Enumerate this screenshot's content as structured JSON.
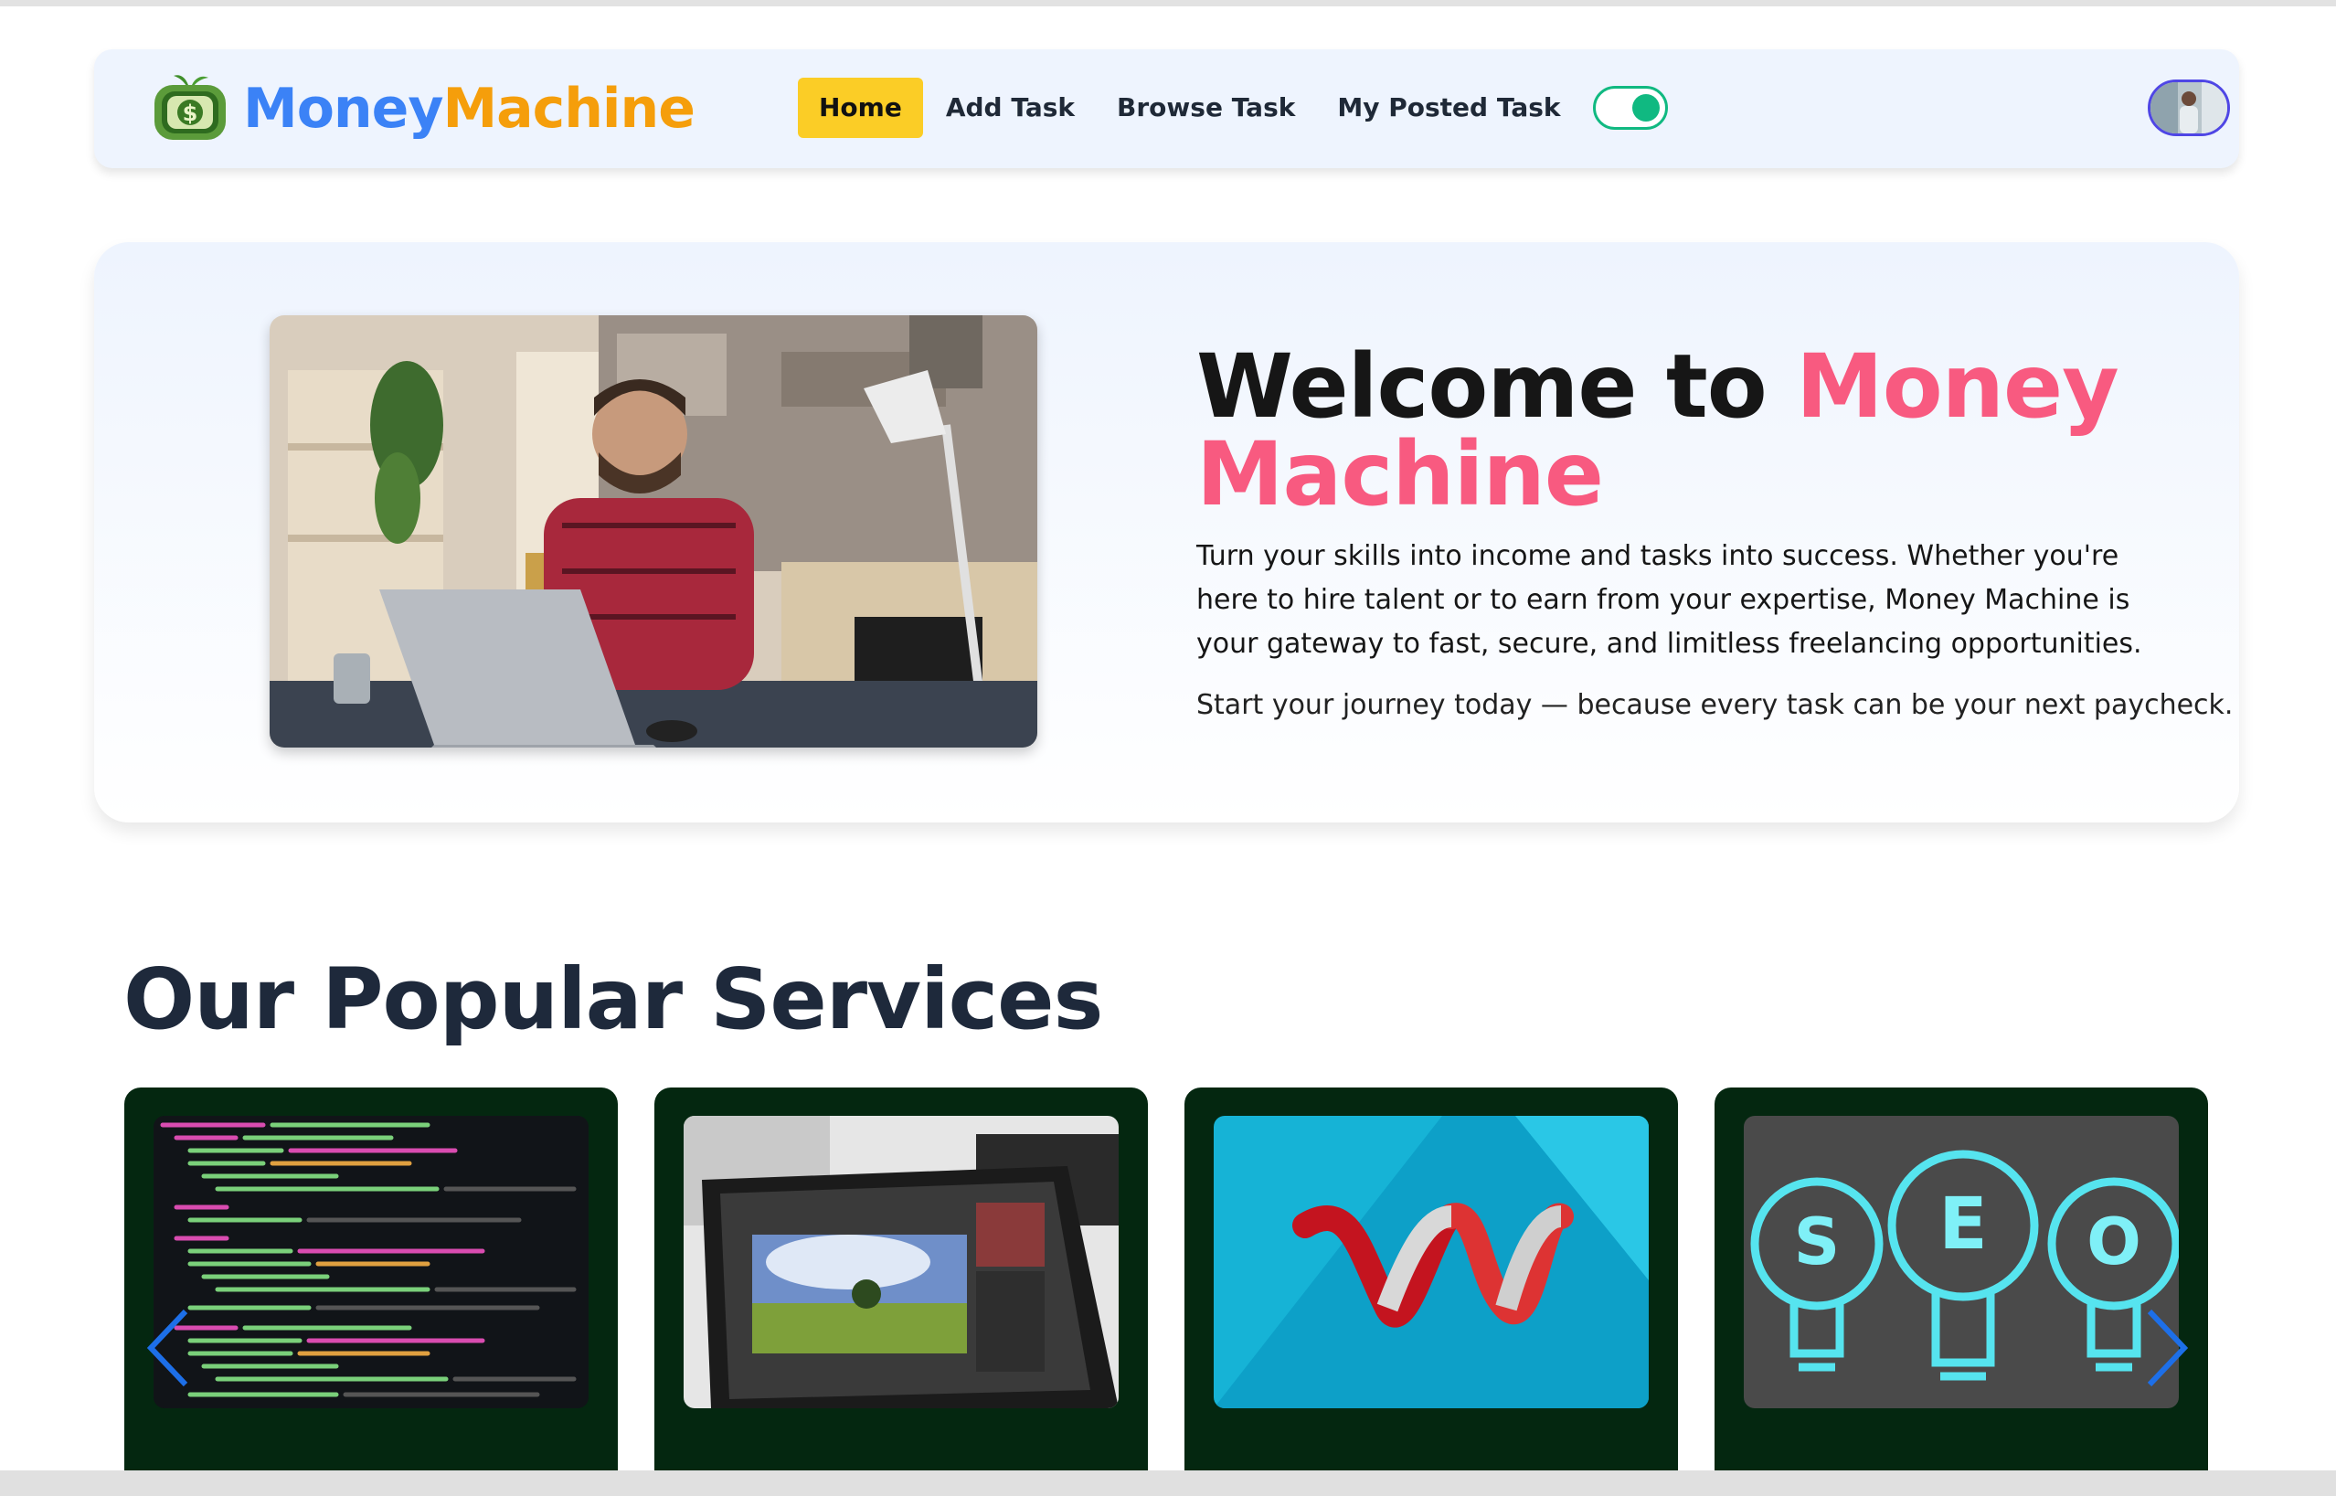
{
  "brand": {
    "name_part1": "Money",
    "name_part2": "Machine",
    "logo_icon": "money-tv-icon"
  },
  "nav": {
    "items": [
      {
        "label": "Home",
        "active": true
      },
      {
        "label": "Add Task",
        "active": false
      },
      {
        "label": "Browse Task",
        "active": false
      },
      {
        "label": "My Posted Task",
        "active": false
      }
    ],
    "theme_toggle": {
      "on": true,
      "color": "#10b981"
    },
    "avatar_icon": "user-avatar"
  },
  "hero": {
    "title_prefix": "Welcome to ",
    "title_highlight": "Money Machine",
    "description": "Turn your skills into income and tasks into success. Whether you're here to hire talent or to earn from your expertise, Money Machine is your gateway to fast, secure, and limitless freelancing opportunities.",
    "subtext": "Start your journey today — because every task can be your next paycheck.",
    "image_icon": "man-working-laptop-photo"
  },
  "services": {
    "title": "Our Popular Services",
    "cards": [
      {
        "image": "code-editor-photo"
      },
      {
        "image": "photo-editing-laptop-photo"
      },
      {
        "image": "ribbon-logo-graphic"
      },
      {
        "image": "seo-lightbulbs-graphic"
      }
    ],
    "prev_icon": "chevron-left-icon",
    "next_icon": "chevron-right-icon"
  },
  "colors": {
    "accent_blue": "#3b82f6",
    "accent_orange": "#f59e0b",
    "accent_pink": "#f85a80",
    "nav_active": "#fbcd26",
    "card_bg": "#042710"
  }
}
